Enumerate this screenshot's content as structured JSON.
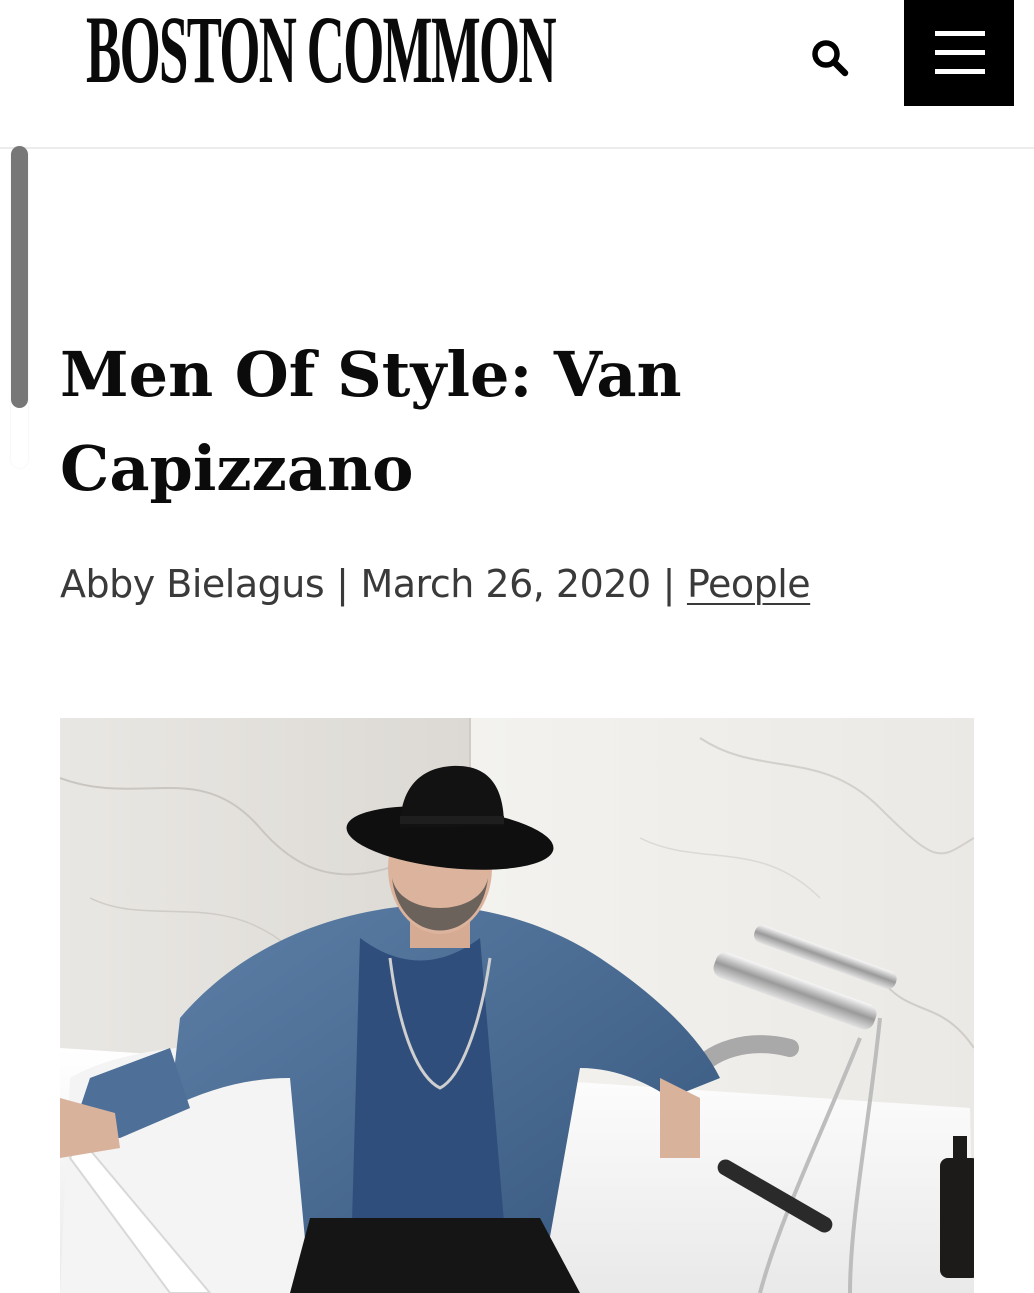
{
  "header": {
    "logo_text": "BOSTON COMMON",
    "search_icon": "search-icon",
    "menu_icon": "hamburger-menu-icon"
  },
  "article": {
    "title": "Men Of Style: Van Capizzano",
    "author": "Abby Bielagus",
    "separator": "|",
    "date": "March 26, 2020",
    "category": "People"
  },
  "hero": {
    "description_icon": "hero-photo"
  },
  "colors": {
    "text": "#0b0b0b",
    "byline": "#3a3a3a",
    "menu_bg": "#000000",
    "scroll_thumb": "#777777"
  }
}
